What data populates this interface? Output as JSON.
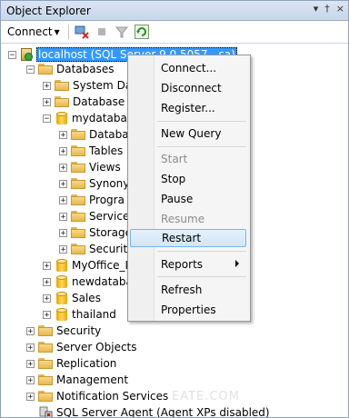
{
  "panel": {
    "title": "Object Explorer",
    "controls": [
      "▾",
      "†",
      "×"
    ]
  },
  "toolbar": {
    "connect_label": "Connect",
    "connect_arrow": "▾"
  },
  "tree": {
    "server": "localhost (SQL Server 9.0.5057 - sa)",
    "databases": "Databases",
    "system_databases": "System Dat",
    "database_snapshots": "Database S",
    "mydatabase": "mydatabas",
    "mydb_children": [
      "Databa",
      "Tables",
      "Views",
      "Synony",
      "Progra",
      "Service",
      "Storage",
      "Security"
    ],
    "other_dbs": [
      "MyOffice_I",
      "newdataba",
      "Sales",
      "thailand"
    ],
    "server_nodes": [
      "Security",
      "Server Objects",
      "Replication",
      "Management",
      "Notification Services"
    ],
    "agent": "SQL Server Agent (Agent XPs disabled)",
    "expander_plus": "+",
    "expander_minus": "−"
  },
  "context_menu": {
    "items": [
      {
        "label": "Connect...",
        "enabled": true
      },
      {
        "label": "Disconnect",
        "enabled": true
      },
      {
        "label": "Register...",
        "enabled": true
      },
      {
        "label": "New Query",
        "enabled": true
      },
      {
        "label": "Start",
        "enabled": false
      },
      {
        "label": "Stop",
        "enabled": true
      },
      {
        "label": "Pause",
        "enabled": true
      },
      {
        "label": "Resume",
        "enabled": false
      },
      {
        "label": "Restart",
        "enabled": true,
        "highlighted": true
      },
      {
        "label": "Reports",
        "enabled": true,
        "submenu": true
      },
      {
        "label": "Refresh",
        "enabled": true
      },
      {
        "label": "Properties",
        "enabled": true
      }
    ]
  },
  "watermark": "EATE.COM",
  "colors": {
    "selection": "#3399ff",
    "menu_hover_border": "#7ab4e6",
    "title_bg": "#c7d6eb"
  }
}
